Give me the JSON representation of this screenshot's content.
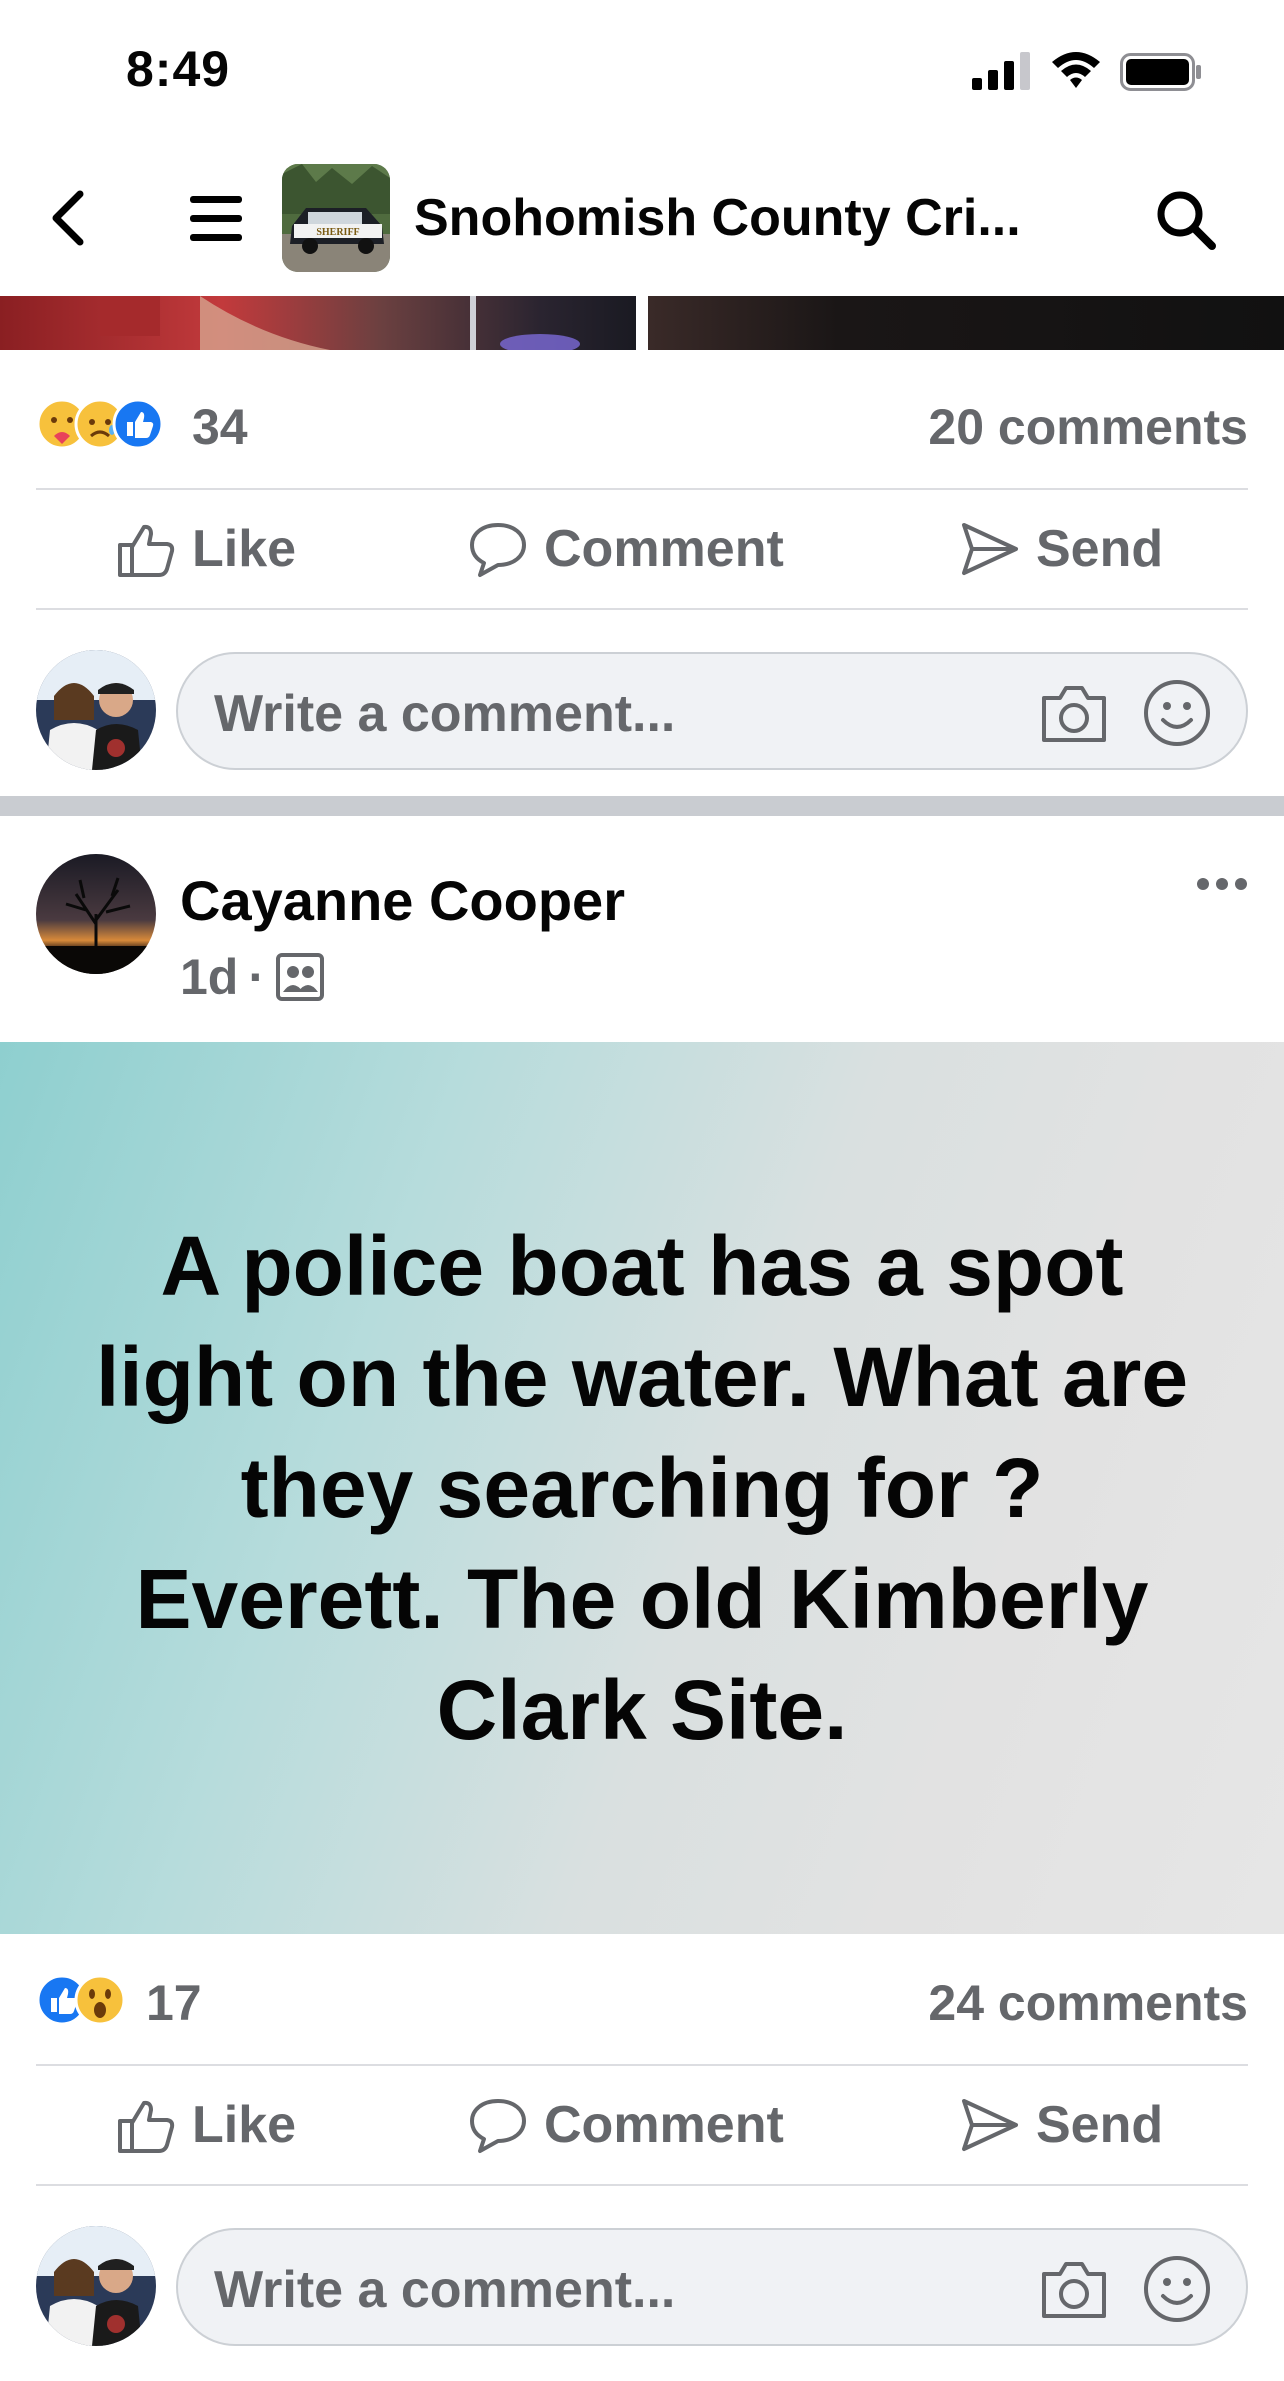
{
  "status_bar": {
    "time": "8:49"
  },
  "nav": {
    "group_title": "Snohomish County Cri..."
  },
  "post_prev": {
    "reaction_icons": [
      "care-icon",
      "sad-icon",
      "like-icon"
    ],
    "reaction_count": "34",
    "comment_count": "20 comments"
  },
  "actions": {
    "like": "Like",
    "comment": "Comment",
    "send": "Send"
  },
  "comment_input": {
    "placeholder": "Write a comment..."
  },
  "post": {
    "author": "Cayanne Cooper",
    "age": "1d",
    "separator": "·",
    "audience_icon": "group-members-icon",
    "text": "A police boat has a spot light on the water. What are they searching for ? Everett. The old Kimberly Clark Site.",
    "reaction_icons": [
      "like-icon",
      "wow-icon"
    ],
    "reaction_count": "17",
    "comment_count": "24 comments"
  },
  "colors": {
    "like_blue": "#1877f2",
    "secondary_text": "#65676b",
    "reaction_yellow": "#f7c13c"
  }
}
